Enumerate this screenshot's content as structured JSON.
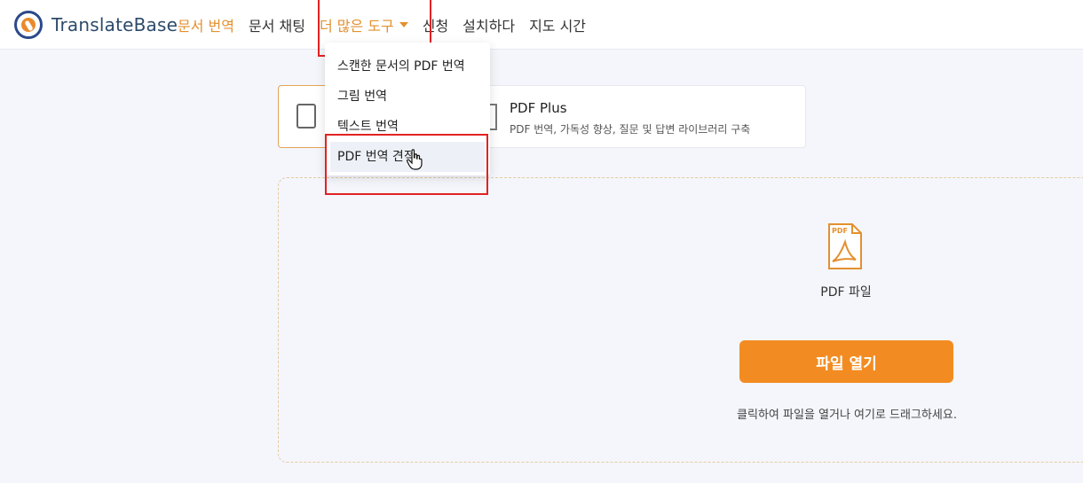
{
  "brand": {
    "name": "TranslateBase"
  },
  "nav": {
    "items": [
      "문서 번역",
      "문서 채팅",
      "신청",
      "설치하다",
      "지도 시간"
    ],
    "more_label": "더 많은 도구"
  },
  "dropdown": {
    "items": [
      "스캔한 문서의 PDF 번역",
      "그림 번역",
      "텍스트 번역",
      "PDF 번역 견적"
    ]
  },
  "cards": {
    "pdf_plus": {
      "title": "PDF Plus",
      "desc": "PDF 번역, 가독성 향상, 질문 및 답변 라이브러리 구축"
    }
  },
  "upload": {
    "file_type_label": "PDF 파일",
    "open_button": "파일 열기",
    "hint": "클릭하여 파일을 열거나 여기로 드래그하세요.",
    "pdf_icon_text": "PDF"
  },
  "colors": {
    "accent": "#e3902f",
    "button": "#f28c22",
    "highlight_box": "#e32222"
  }
}
